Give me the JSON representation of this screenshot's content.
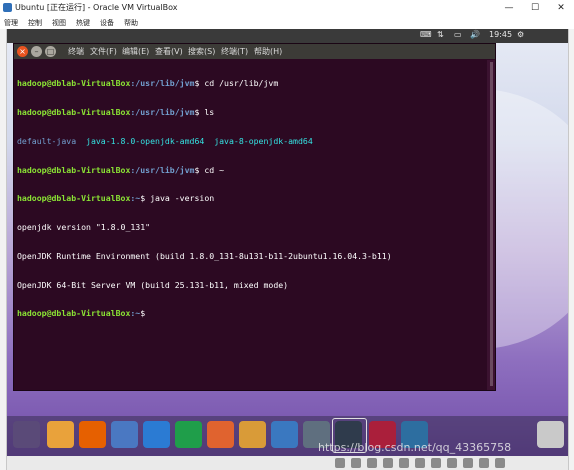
{
  "window": {
    "title": "Ubuntu [正在运行] - Oracle VM VirtualBox",
    "minimize": "—",
    "maximize": "☐",
    "close": "✕"
  },
  "vbox_menu": {
    "items": [
      "管理",
      "控制",
      "视图",
      "热键",
      "设备",
      "帮助"
    ]
  },
  "top_panel": {
    "time": "19:45",
    "icons": [
      "keyboard-layout-icon",
      "network-icon",
      "battery-icon",
      "volume-icon",
      "settings-icon"
    ]
  },
  "terminal": {
    "menu": [
      "终端",
      "文件(F)",
      "编辑(E)",
      "查看(V)",
      "搜索(S)",
      "终端(T)",
      "帮助(H)"
    ],
    "prompt_user": "hadoop@dblab-VirtualBox",
    "lines": [
      {
        "path": ":/usr/lib/jvm",
        "cmd": "$ cd /usr/lib/jvm"
      },
      {
        "path": ":/usr/lib/jvm",
        "cmd": "$ ls"
      },
      {
        "ls": [
          "default-java",
          "java-1.8.0-openjdk-amd64",
          "java-8-openjdk-amd64"
        ]
      },
      {
        "path": ":/usr/lib/jvm",
        "cmd": "$ cd ~"
      },
      {
        "path": ":~",
        "cmd": "$ java -version"
      },
      {
        "out": "openjdk version \"1.8.0_131\""
      },
      {
        "out": "OpenJDK Runtime Environment (build 1.8.0_131-8u131-b11-2ubuntu1.16.04.3-b11)"
      },
      {
        "out": "OpenJDK 64-Bit Server VM (build 25.131-b11, mixed mode)"
      },
      {
        "path": ":~",
        "cmd": "$"
      }
    ]
  },
  "dock": {
    "apps": [
      {
        "name": "ubuntu-logo-icon",
        "color": "#5a4a78"
      },
      {
        "name": "files-icon",
        "color": "#e9a23b"
      },
      {
        "name": "firefox-icon",
        "color": "#e66000"
      },
      {
        "name": "chromium-icon",
        "color": "#4a78c2"
      },
      {
        "name": "wps-writer-icon",
        "color": "#2b7bd3"
      },
      {
        "name": "wps-spreadsheet-icon",
        "color": "#1f9e4a"
      },
      {
        "name": "wps-presentation-icon",
        "color": "#e0632f"
      },
      {
        "name": "text-editor-icon",
        "color": "#d99b38"
      },
      {
        "name": "uk-software-icon",
        "color": "#3a78c0"
      },
      {
        "name": "disk-utility-icon",
        "color": "#5f6f7f"
      },
      {
        "name": "terminal-icon",
        "color": "#2f3b4c"
      },
      {
        "name": "screen-recorder-icon",
        "color": "#aa1f3b"
      },
      {
        "name": "workspace-switcher-icon",
        "color": "#2d6ea0"
      },
      {
        "name": "trash-icon",
        "color": "#c9c9c9"
      }
    ]
  },
  "watermark": "https://blog.csdn.net/qq_43365758"
}
